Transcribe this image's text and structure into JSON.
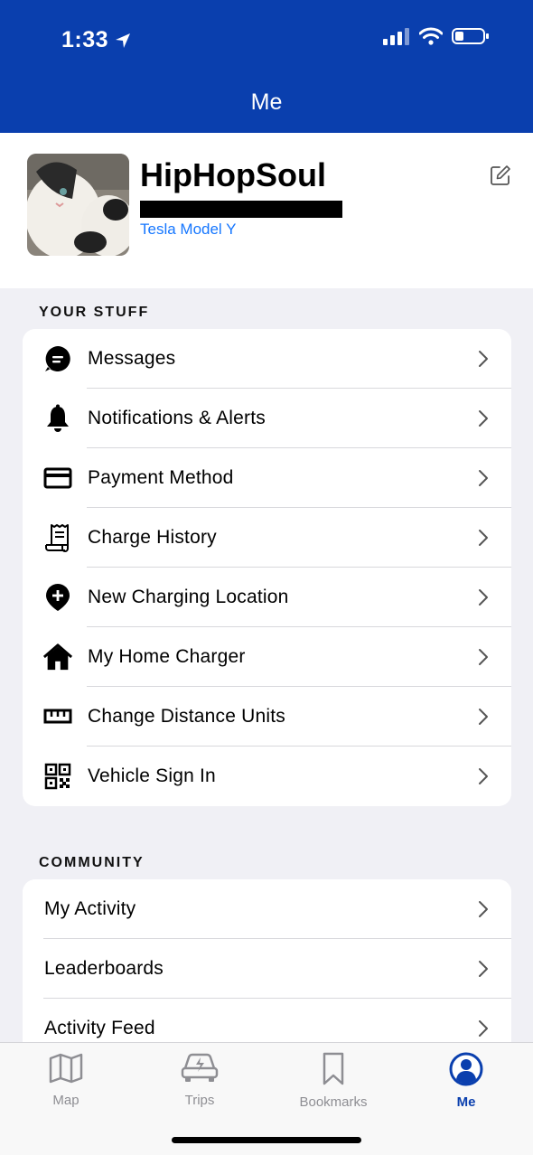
{
  "status": {
    "time": "1:33"
  },
  "nav": {
    "title": "Me"
  },
  "profile": {
    "username": "HipHopSoul",
    "vehicle": "Tesla Model Y"
  },
  "your_stuff": {
    "heading": "YOUR STUFF",
    "items": [
      {
        "label": "Messages",
        "icon": "message-icon"
      },
      {
        "label": "Notifications & Alerts",
        "icon": "bell-icon"
      },
      {
        "label": "Payment Method",
        "icon": "credit-card-icon"
      },
      {
        "label": "Charge History",
        "icon": "receipt-icon"
      },
      {
        "label": "New Charging Location",
        "icon": "map-pin-plus-icon"
      },
      {
        "label": "My Home Charger",
        "icon": "home-icon"
      },
      {
        "label": "Change Distance Units",
        "icon": "ruler-icon"
      },
      {
        "label": "Vehicle Sign In",
        "icon": "qr-code-icon"
      }
    ]
  },
  "community": {
    "heading": "COMMUNITY",
    "items": [
      {
        "label": "My Activity"
      },
      {
        "label": "Leaderboards"
      },
      {
        "label": "Activity Feed"
      }
    ]
  },
  "tabs": [
    {
      "label": "Map",
      "icon": "map-icon"
    },
    {
      "label": "Trips",
      "icon": "car-charge-icon"
    },
    {
      "label": "Bookmarks",
      "icon": "bookmark-icon"
    },
    {
      "label": "Me",
      "icon": "person-icon",
      "active": true
    }
  ],
  "colors": {
    "brand": "#0a3fae",
    "link": "#1677ff",
    "background": "#f0f0f5"
  }
}
